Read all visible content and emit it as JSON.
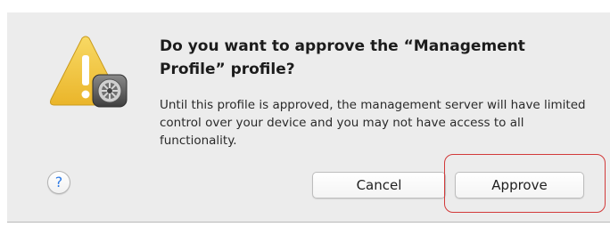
{
  "dialog": {
    "title": "Do you want to approve the “Management Profile” profile?",
    "message": "Until this profile is approved, the management server will have limited control over your device and you may not have access to all functionality.",
    "help_label": "?",
    "cancel_label": "Cancel",
    "approve_label": "Approve"
  },
  "icons": {
    "alert": "warning-triangle-icon",
    "badge": "system-preferences-gear-icon"
  },
  "colors": {
    "dialog_background": "#ececec",
    "warning_yellow": "#f3c844",
    "help_blue": "#2d7ae5",
    "highlight_red": "#d23a3a"
  }
}
